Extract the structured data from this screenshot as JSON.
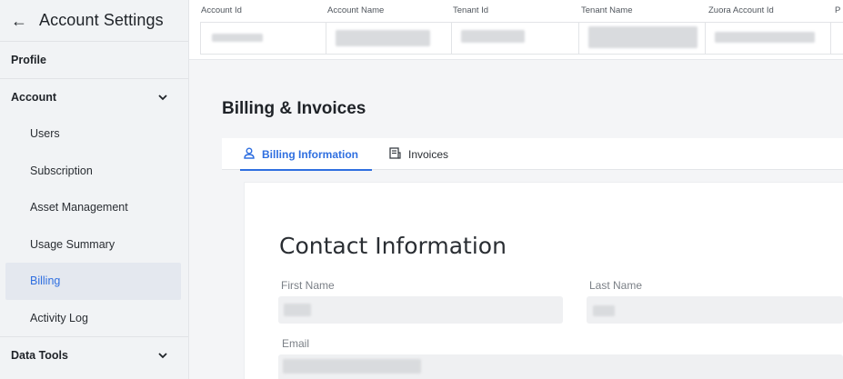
{
  "sidebar": {
    "back_arrow": "←",
    "title": "Account Settings",
    "sections": {
      "profile": "Profile",
      "account": "Account",
      "data_tools": "Data Tools"
    },
    "account_items": [
      "Users",
      "Subscription",
      "Asset Management",
      "Usage Summary",
      "Billing",
      "Activity Log"
    ],
    "active_item": "Billing"
  },
  "account_table": {
    "headers": [
      "Account Id",
      "Account Name",
      "Tenant Id",
      "Tenant Name",
      "Zuora Account Id",
      "P"
    ]
  },
  "main": {
    "heading": "Billing & Invoices",
    "tabs": [
      {
        "label": "Billing Information",
        "icon": "user-icon",
        "active": true
      },
      {
        "label": "Invoices",
        "icon": "invoice-icon",
        "active": false
      }
    ],
    "form": {
      "title": "Contact Information",
      "first_name_label": "First Name",
      "last_name_label": "Last Name",
      "email_label": "Email"
    }
  },
  "colors": {
    "accent": "#2f6fe0",
    "sidebar_bg": "#f1f3f5",
    "active_bg": "#e4e8ef"
  }
}
